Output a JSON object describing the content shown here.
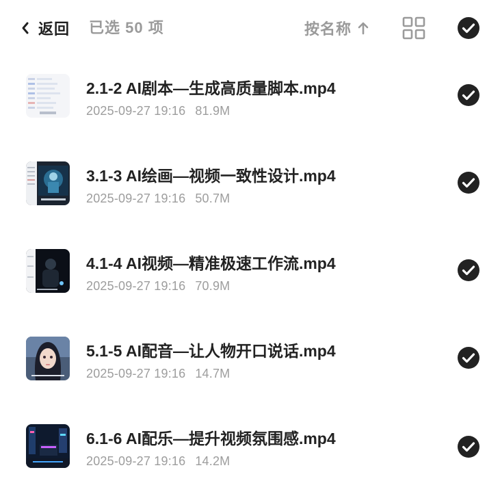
{
  "header": {
    "back_label": "返回",
    "selected_label": "已选 50 项",
    "sort_label": "按名称",
    "icons": {
      "back": "chevron-left-icon",
      "sort": "arrow-up-icon",
      "view": "grid-view-icon",
      "select_all": "checkmark-circle-icon"
    }
  },
  "files": [
    {
      "name": "2.1-2 AI剧本—生成高质量脚本.mp4",
      "date": "2025-09-27 19:16",
      "size": "81.9M",
      "selected": true
    },
    {
      "name": "3.1-3 AI绘画—视频一致性设计.mp4",
      "date": "2025-09-27 19:16",
      "size": "50.7M",
      "selected": true
    },
    {
      "name": "4.1-4 AI视频—精准极速工作流.mp4",
      "date": "2025-09-27 19:16",
      "size": "70.9M",
      "selected": true
    },
    {
      "name": "5.1-5 AI配音—让人物开口说话.mp4",
      "date": "2025-09-27 19:16",
      "size": "14.7M",
      "selected": true
    },
    {
      "name": "6.1-6 AI配乐—提升视频氛围感.mp4",
      "date": "2025-09-27 19:16",
      "size": "14.2M",
      "selected": true
    }
  ],
  "colors": {
    "text_primary": "#222222",
    "text_secondary": "#9d9d9d",
    "check_fill": "#222222"
  }
}
